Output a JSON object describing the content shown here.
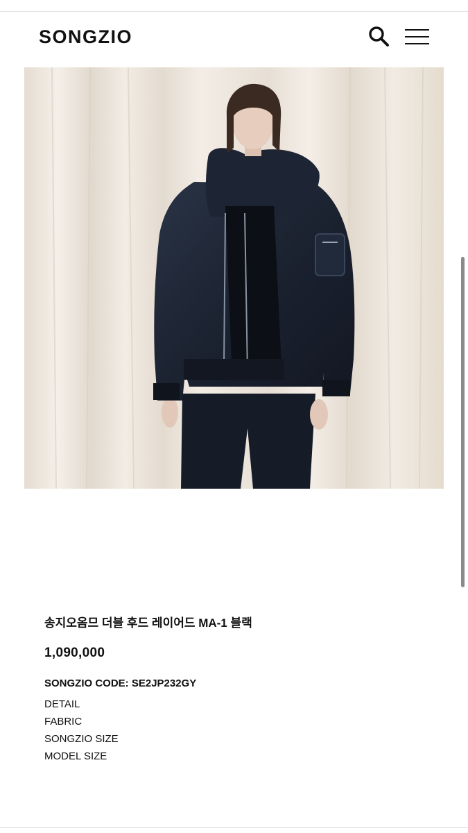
{
  "header": {
    "logo": "SONGZIO",
    "icons": {
      "search": "search-icon",
      "menu": "hamburger-menu-icon"
    }
  },
  "hero": {
    "image": "product-photo-model-wearing-black-hooded-ma1-jacket"
  },
  "product": {
    "name": "송지오옴므 더블 후드 레이어드 MA-1 블랙",
    "price": "1,090,000",
    "code": "SONGZIO CODE: SE2JP232GY",
    "info_links": [
      {
        "label": "DETAIL"
      },
      {
        "label": "FABRIC"
      },
      {
        "label": "SONGZIO SIZE"
      },
      {
        "label": "MODEL SIZE"
      }
    ]
  },
  "colors": {
    "text": "#111111",
    "background": "#ffffff",
    "jacket": "#1c2331",
    "curtain": "#ece5dc"
  }
}
